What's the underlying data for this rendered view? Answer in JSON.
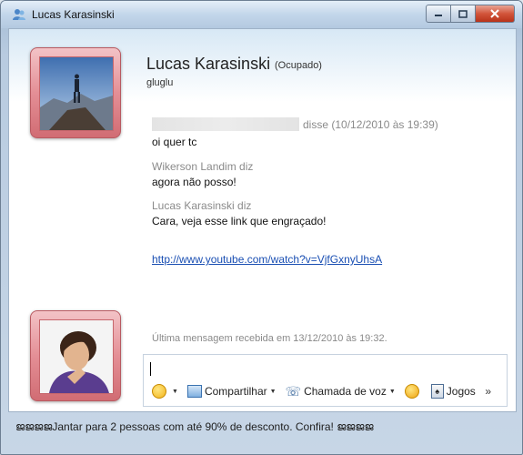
{
  "window": {
    "title": "Lucas Karasinski"
  },
  "contact": {
    "name": "Lucas Karasinski",
    "status": "(Ocupado)",
    "personal_message": "gluglu"
  },
  "messages": [
    {
      "sender_suffix": "disse (10/12/2010 às 19:39)",
      "text": "oi quer tc"
    },
    {
      "sender": "Wikerson Landim diz",
      "text": "agora não posso!"
    },
    {
      "sender": "Lucas Karasinski diz",
      "text": "Cara, veja esse link que engraçado!"
    }
  ],
  "link": "http://www.youtube.com/watch?v=VjfGxnyUhsA",
  "last_message": "Última mensagem recebida em 13/12/2010 às 19:32.",
  "toolbar": {
    "share_label": "Compartilhar",
    "voice_label": "Chamada de voz",
    "games_label": "Jogos",
    "more_label": "»"
  },
  "ad_text": "ജജജജJantar para 2 pessoas com até 90% de desconto. Confira! ജജജജ",
  "icons": {
    "app": "messenger-icon",
    "emoticon": "smiley-icon",
    "share": "share-icon",
    "voice": "phone-icon",
    "wink": "wink-icon",
    "games": "games-icon"
  },
  "colors": {
    "link": "#1a4fb3",
    "frame": "#e48f96",
    "close_button": "#d2553b"
  }
}
